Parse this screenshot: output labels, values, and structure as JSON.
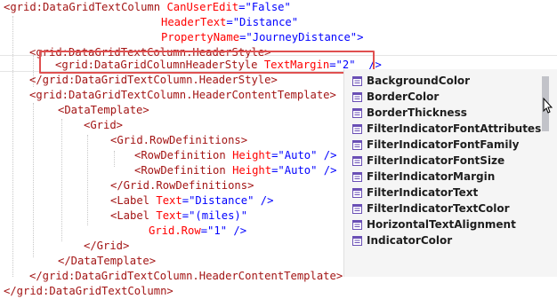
{
  "editor": {
    "lines": [
      {
        "parts": [
          {
            "k": "t",
            "s": "<grid:DataGridTextColumn "
          },
          {
            "k": "a",
            "s": "CanUserEdit"
          },
          {
            "k": "v",
            "s": "=\"False\""
          }
        ]
      },
      {
        "parts": [
          {
            "k": "a",
            "s": "HeaderText"
          },
          {
            "k": "v",
            "s": "=\"Distance\""
          }
        ]
      },
      {
        "parts": [
          {
            "k": "a",
            "s": "PropertyName"
          },
          {
            "k": "v",
            "s": "=\"JourneyDistance\">"
          }
        ]
      },
      {
        "parts": [
          {
            "k": "t",
            "s": "<grid:DataGridTextColumn.HeaderStyle>"
          }
        ]
      },
      {
        "parts": [
          {
            "k": "t",
            "s": "<grid:DataGridColumnHeaderStyle "
          },
          {
            "k": "a",
            "s": "TextMargin"
          },
          {
            "k": "v",
            "s": "=\"2\"  />"
          }
        ]
      },
      {
        "parts": [
          {
            "k": "t",
            "s": "</grid:DataGridTextColumn.HeaderStyle>"
          }
        ]
      },
      {
        "parts": [
          {
            "k": "t",
            "s": "<grid:DataGridTextColumn.HeaderContentTemplate>"
          }
        ]
      },
      {
        "parts": [
          {
            "k": "t",
            "s": "<DataTemplate>"
          }
        ]
      },
      {
        "parts": [
          {
            "k": "t",
            "s": "<Grid>"
          }
        ]
      },
      {
        "parts": [
          {
            "k": "t",
            "s": "<Grid.RowDefinitions>"
          }
        ]
      },
      {
        "parts": [
          {
            "k": "t",
            "s": "<RowDefinition "
          },
          {
            "k": "a",
            "s": "Height"
          },
          {
            "k": "v",
            "s": "=\"Auto\" />"
          }
        ]
      },
      {
        "parts": [
          {
            "k": "t",
            "s": "<RowDefinition "
          },
          {
            "k": "a",
            "s": "Height"
          },
          {
            "k": "v",
            "s": "=\"Auto\" />"
          }
        ]
      },
      {
        "parts": [
          {
            "k": "t",
            "s": "</Grid.RowDefinitions>"
          }
        ]
      },
      {
        "parts": []
      },
      {
        "parts": [
          {
            "k": "t",
            "s": "<Label "
          },
          {
            "k": "a",
            "s": "Text"
          },
          {
            "k": "v",
            "s": "=\"Distance\" />"
          }
        ]
      },
      {
        "parts": [
          {
            "k": "t",
            "s": "<Label "
          },
          {
            "k": "a",
            "s": "Text"
          },
          {
            "k": "v",
            "s": "=\"(miles)\""
          }
        ]
      },
      {
        "parts": [
          {
            "k": "a",
            "s": "Grid.Row"
          },
          {
            "k": "v",
            "s": "=\"1\" />"
          }
        ]
      },
      {
        "parts": [
          {
            "k": "t",
            "s": "</Grid>"
          }
        ]
      },
      {
        "parts": [
          {
            "k": "t",
            "s": "</DataTemplate>"
          }
        ]
      },
      {
        "parts": [
          {
            "k": "t",
            "s": "</grid:DataGridTextColumn.HeaderContentTemplate>"
          }
        ]
      },
      {
        "parts": [
          {
            "k": "t",
            "s": "</grid:DataGridTextColumn>"
          }
        ]
      }
    ]
  },
  "intellisense": {
    "items": [
      {
        "label": "BackgroundColor"
      },
      {
        "label": "BorderColor"
      },
      {
        "label": "BorderThickness"
      },
      {
        "label": "FilterIndicatorFontAttributes"
      },
      {
        "label": "FilterIndicatorFontFamily"
      },
      {
        "label": "FilterIndicatorFontSize"
      },
      {
        "label": "FilterIndicatorMargin"
      },
      {
        "label": "FilterIndicatorText"
      },
      {
        "label": "FilterIndicatorTextColor"
      },
      {
        "label": "HorizontalTextAlignment"
      },
      {
        "label": "IndicatorColor"
      }
    ],
    "icon": "property-icon"
  },
  "colors": {
    "tag": "#a31515",
    "attribute": "#ff0000",
    "value": "#0000ff",
    "highlight_border": "#e05050",
    "popup_background": "#f5f5f5",
    "property_icon": "#6a4fb5"
  }
}
